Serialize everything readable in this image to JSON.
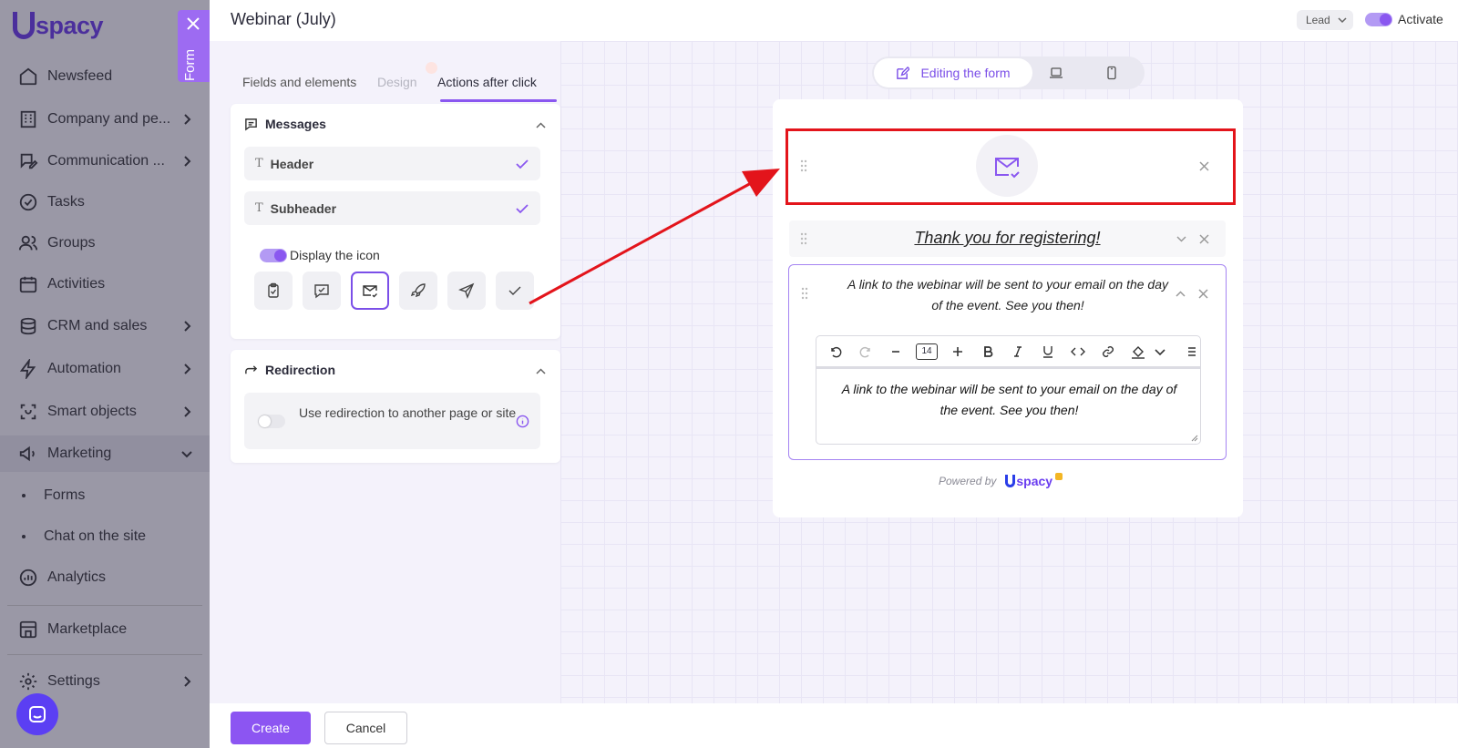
{
  "app": {
    "logo_text": "spacy"
  },
  "sidebar": {
    "items": [
      {
        "label": "Newsfeed",
        "icon": "home-icon",
        "has_arrow": false
      },
      {
        "label": "Company and pe...",
        "icon": "building-icon",
        "has_arrow": true
      },
      {
        "label": "Communication ...",
        "icon": "chat-edit-icon",
        "has_arrow": true
      },
      {
        "label": "Tasks",
        "icon": "check-circle-icon",
        "has_arrow": false
      },
      {
        "label": "Groups",
        "icon": "users-icon",
        "has_arrow": false
      },
      {
        "label": "Activities",
        "icon": "calendar-icon",
        "has_arrow": false
      },
      {
        "label": "CRM and sales",
        "icon": "coins-icon",
        "has_arrow": true
      },
      {
        "label": "Automation",
        "icon": "bolt-icon",
        "has_arrow": true
      },
      {
        "label": "Smart objects",
        "icon": "scan-icon",
        "has_arrow": true
      },
      {
        "label": "Marketing",
        "icon": "megaphone-icon",
        "has_arrow": true
      }
    ],
    "sub_items": [
      "Forms",
      "Chat on the site"
    ],
    "bottom_items": [
      {
        "label": "Analytics",
        "icon": "chart-icon"
      },
      {
        "label": "Marketplace",
        "icon": "store-icon"
      },
      {
        "label": "Settings",
        "icon": "gear-icon"
      }
    ]
  },
  "form_tab": {
    "label": "Form"
  },
  "header": {
    "title": "Webinar (July)",
    "entity_select": "Lead",
    "activate_label": "Activate",
    "activate_on": true
  },
  "settings": {
    "tabs": [
      {
        "label": "Fields and elements",
        "active": false,
        "disabled": false
      },
      {
        "label": "Design",
        "active": false,
        "disabled": true
      },
      {
        "label": "Actions after click",
        "active": true,
        "disabled": false
      }
    ],
    "messages": {
      "title": "Messages",
      "rows": [
        {
          "label": "Header",
          "checked": true
        },
        {
          "label": "Subheader",
          "checked": true
        }
      ],
      "display_icon_label": "Display the icon",
      "display_icon_on": true,
      "icon_options": [
        "clipboard-check-icon",
        "chat-check-icon",
        "mail-check-icon",
        "rocket-icon",
        "send-icon",
        "check-icon"
      ],
      "selected_icon": "mail-check-icon"
    },
    "redirection": {
      "title": "Redirection",
      "label": "Use redirection to another page or site",
      "enabled": false
    }
  },
  "preview": {
    "view_modes": [
      {
        "label": "Editing the form",
        "icon": "edit-icon",
        "active": true
      },
      {
        "label": "",
        "icon": "laptop-icon",
        "active": false
      },
      {
        "label": "",
        "icon": "phone-icon",
        "active": false
      }
    ],
    "header_text": "Thank you for registering!",
    "subheader_text": "A link to the webinar will be sent to your email on the day of the event. See you then!",
    "editor": {
      "font_size": "14",
      "text": "A link to the webinar will be sent to your email on the day of the event. See you then!"
    },
    "powered_by": "Powered by",
    "powered_logo": "spacy",
    "highlight_color": "#e3141b"
  },
  "footer": {
    "create_label": "Create",
    "cancel_label": "Cancel"
  },
  "colors": {
    "accent": "#8a57f0",
    "sidebar_bg": "#9a98a6",
    "annotation_red": "#e3141b"
  }
}
